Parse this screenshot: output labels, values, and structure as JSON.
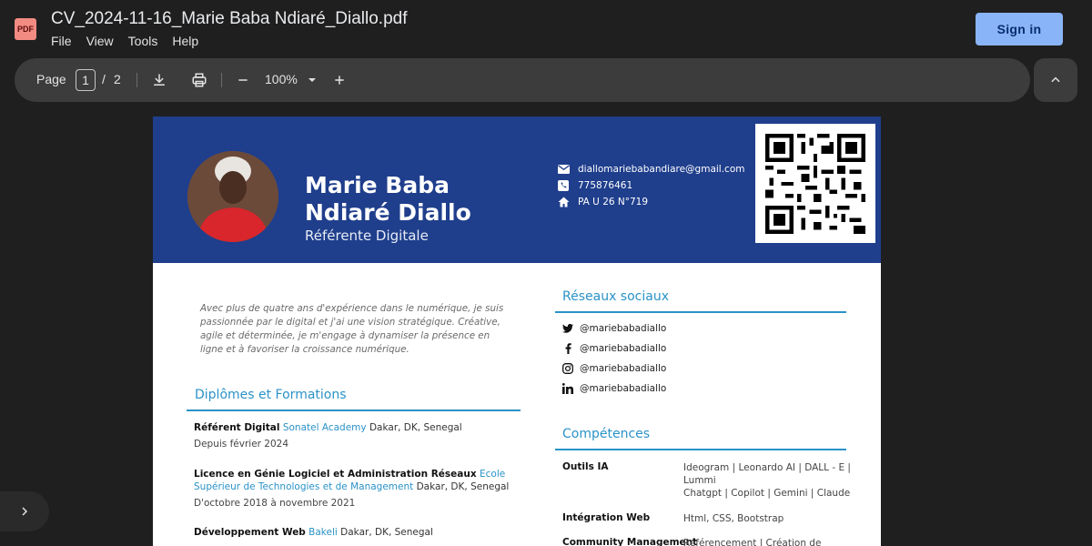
{
  "app": {
    "file_title": "CV_2024-11-16_Marie Baba Ndiaré_Diallo.pdf",
    "badge": "PDF",
    "menu": [
      "File",
      "View",
      "Tools",
      "Help"
    ],
    "sign_in": "Sign in"
  },
  "toolbar": {
    "page_label": "Page",
    "current_page": "1",
    "separator": "/",
    "total_pages": "2",
    "zoom": "100%",
    "icons": [
      "download-icon",
      "print-icon",
      "zoom-out-icon",
      "zoom-dropdown-icon",
      "zoom-in-icon",
      "collapse-icon",
      "sidebar-toggle-icon"
    ]
  },
  "colors": {
    "banner": "#1f3e8c",
    "accent": "#2a92c7",
    "signin": "#8ab4f8",
    "toolbar": "#3c3c3c",
    "background": "#1f1f1f"
  },
  "cv": {
    "name": "Marie Baba Ndiaré Diallo",
    "role": "Référente Digitale",
    "contact": {
      "email": "diallomariebabandiare@gmail.com",
      "phone": "775876461",
      "address": "PA U 26 N°719"
    },
    "summary": "Avec plus de quatre ans d'expérience dans le numérique, je suis passionnée par le digital et j'ai une vision stratégique. Créative, agile et déterminée, je m'engage à dynamiser la présence en ligne et à favoriser la croissance numérique.",
    "education_title": "Diplômes et Formations",
    "education": [
      {
        "title": "Référent Digital",
        "school": "Sonatel Academy",
        "place": "Dakar, DK, Senegal",
        "date": "Depuis février 2024"
      },
      {
        "title": "Licence en Génie Logiciel et Administration Réseaux",
        "school": "Ecole Supérieur de Technologies et de Management",
        "place": "Dakar, DK, Senegal",
        "date": "D'octobre 2018 à novembre 2021"
      },
      {
        "title": "Développement Web",
        "school": "Bakeli",
        "place": "Dakar, DK, Senegal",
        "date": ""
      }
    ],
    "social_title": "Réseaux sociaux",
    "social": [
      {
        "network": "twitter-icon",
        "handle": "@mariebabadiallo"
      },
      {
        "network": "facebook-icon",
        "handle": "@mariebabadiallo"
      },
      {
        "network": "instagram-icon",
        "handle": "@mariebabadiallo"
      },
      {
        "network": "linkedin-icon",
        "handle": "@mariebabadiallo"
      }
    ],
    "skills_title": "Compétences",
    "skills": [
      {
        "name": "Outils IA",
        "value": "Ideogram | Leonardo AI | DALL - E | Lummi\nChatgpt | Copilot | Gemini | Claude"
      },
      {
        "name": "Intégration Web",
        "value": "Html, CSS, Bootstrap"
      },
      {
        "name": "Community Management",
        "value": "Référencement | Création de"
      }
    ]
  }
}
